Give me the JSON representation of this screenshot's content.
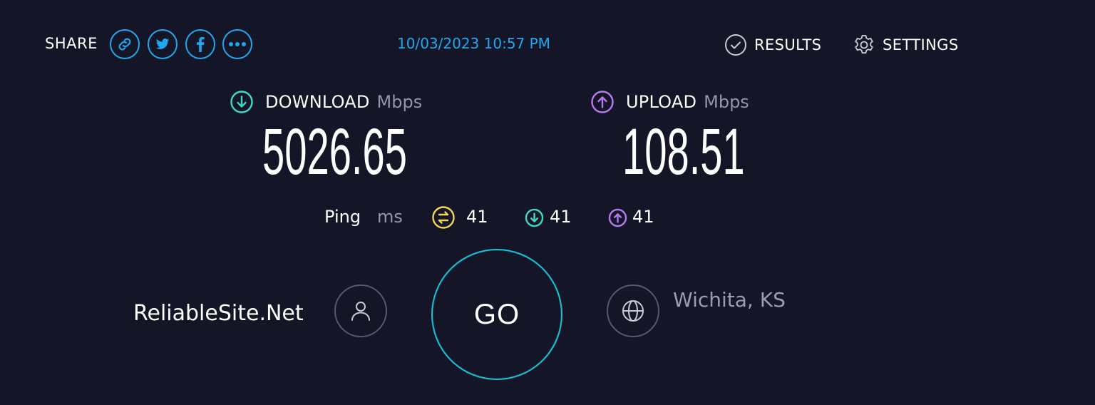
{
  "share": {
    "label": "SHARE",
    "buttons": [
      {
        "name": "link",
        "icon": "link-icon"
      },
      {
        "name": "twitter",
        "icon": "twitter-icon"
      },
      {
        "name": "facebook",
        "icon": "facebook-icon"
      },
      {
        "name": "more",
        "icon": "more-dots-icon"
      }
    ]
  },
  "timestamp": "10/03/2023 10:57 PM",
  "nav": {
    "results_label": "RESULTS",
    "settings_label": "SETTINGS"
  },
  "download": {
    "title": "DOWNLOAD",
    "unit": "Mbps",
    "value": "5026.65",
    "icon": "download-arrow-icon",
    "color": "#3fd8c8"
  },
  "upload": {
    "title": "UPLOAD",
    "unit": "Mbps",
    "value": "108.51",
    "icon": "upload-arrow-icon",
    "color": "#b47af0"
  },
  "ping": {
    "label": "Ping",
    "unit": "ms",
    "idle": {
      "value": "41",
      "icon": "ping-icon",
      "color": "#f3d45a"
    },
    "download": {
      "value": "41",
      "icon": "download-arrow-icon",
      "color": "#3fd8c8"
    },
    "upload": {
      "value": "41",
      "icon": "upload-arrow-icon",
      "color": "#b47af0"
    }
  },
  "provider": {
    "name": "ReliableSite.Net",
    "icon": "user-icon"
  },
  "go_button": {
    "label": "GO",
    "color": "#1dc0d6"
  },
  "server": {
    "location": "Wichita, KS",
    "icon": "globe-icon"
  },
  "colors": {
    "background": "#141526",
    "accent": "#1fa7f0"
  }
}
